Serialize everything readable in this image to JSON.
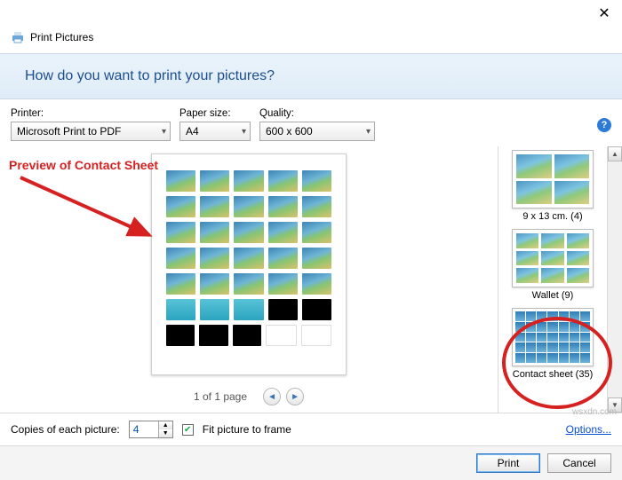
{
  "window": {
    "title": "Print Pictures"
  },
  "banner": {
    "question": "How do you want to print your pictures?"
  },
  "controls": {
    "printer_label": "Printer:",
    "printer_value": "Microsoft Print to PDF",
    "paper_label": "Paper size:",
    "paper_value": "A4",
    "quality_label": "Quality:",
    "quality_value": "600 x 600"
  },
  "annotation": "Preview of Contact Sheet",
  "pager": {
    "text": "1 of 1 page"
  },
  "layouts": {
    "items": [
      {
        "label": "9 x 13 cm. (4)"
      },
      {
        "label": "Wallet (9)"
      },
      {
        "label": "Contact sheet (35)"
      }
    ]
  },
  "bottom": {
    "copies_label": "Copies of each picture:",
    "copies_value": "4",
    "fit_label": "Fit picture to frame",
    "options_link": "Options..."
  },
  "footer": {
    "print": "Print",
    "cancel": "Cancel"
  },
  "watermark": "wsxdn.com"
}
